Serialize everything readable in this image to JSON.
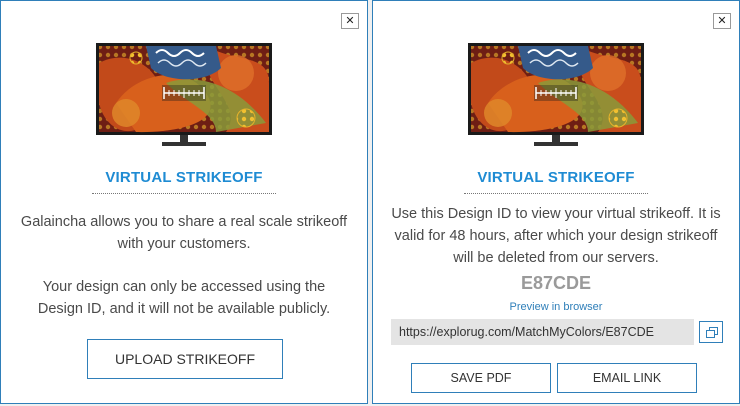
{
  "colors": {
    "accent": "#1e8bd3",
    "border": "#2f7fb9",
    "muted_text": "#9a9a9a",
    "body_text": "#4a4a4a"
  },
  "left_dialog": {
    "close_symbol": "✕",
    "image_icon": "tv-with-ruler-icon",
    "title": "VIRTUAL STRIKEOFF",
    "paragraph_1": "Galaincha allows you to share a real scale strikeoff with your customers.",
    "paragraph_2": "Your design can only be accessed using the Design ID, and it will not be available publicly.",
    "upload_button": "UPLOAD STRIKEOFF"
  },
  "right_dialog": {
    "close_symbol": "✕",
    "image_icon": "tv-with-ruler-icon",
    "title": "VIRTUAL STRIKEOFF",
    "paragraph": "Use this Design ID to view your virtual strikeoff. It is valid for 48 hours, after which your design strikeoff will be deleted from our servers.",
    "design_id": "E87CDE",
    "preview_link": "Preview in browser",
    "url": "https://explorug.com/MatchMyColors/E87CDE",
    "copy_icon": "copy-icon",
    "save_pdf_button": "SAVE PDF",
    "email_link_button": "EMAIL LINK"
  }
}
